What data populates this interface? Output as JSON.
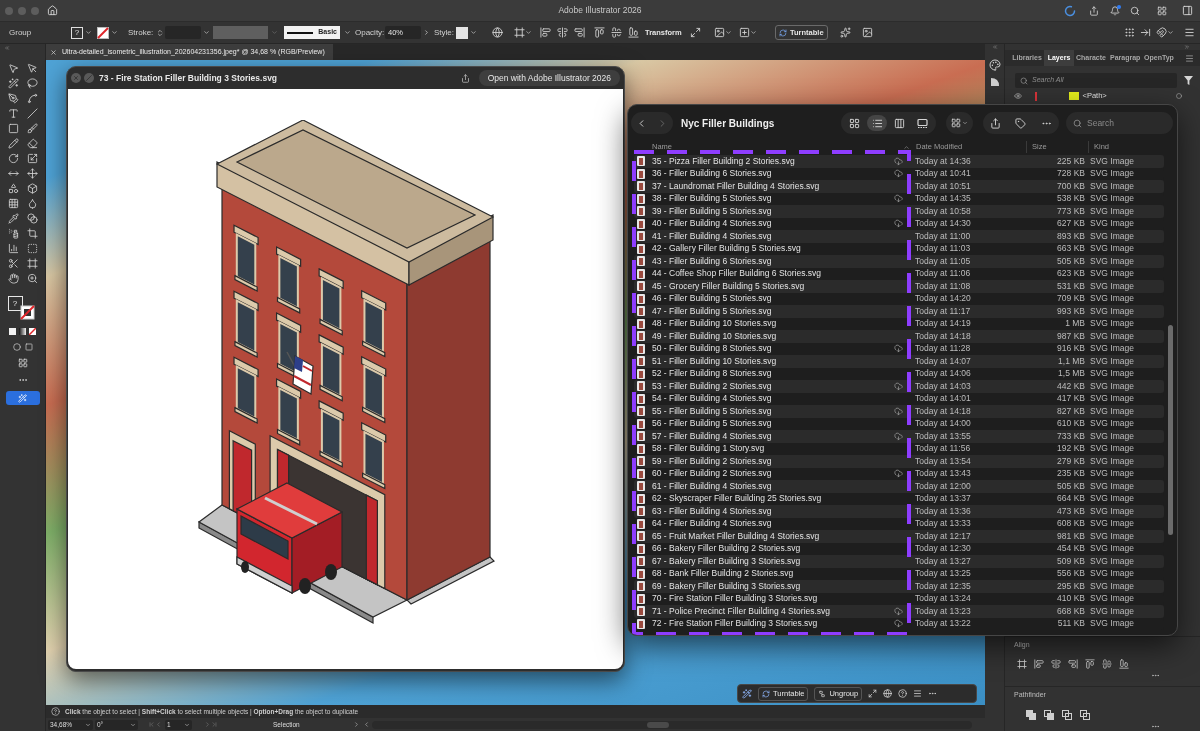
{
  "app": {
    "title": "Adobe Illustrator 2026"
  },
  "control_bar": {
    "selection": "Group",
    "fill": "?",
    "stroke_label": "Stroke:",
    "brush": "Basic",
    "opacity_label": "Opacity:",
    "opacity": "40%",
    "style_label": "Style:",
    "transform": "Transform",
    "turntable": "Turntable"
  },
  "tools": {
    "fill": "?"
  },
  "document_tab": {
    "title": "Ultra-detailed_isometric_illustration_202604231356.jpeg* @ 34,68 % (RGB/Preview)"
  },
  "quick_look": {
    "title": "73 - Fire Station Filler Building 3 Stories.svg",
    "open_button": "Open with Adobe Illustrator 2026"
  },
  "finder": {
    "title": "Nyc Filler Buildings",
    "view_modes": [
      {
        "kind": "icons",
        "selected": false
      },
      {
        "kind": "list",
        "selected": true
      },
      {
        "kind": "columns",
        "selected": false
      },
      {
        "kind": "gallery",
        "selected": false
      }
    ],
    "search": {
      "placeholder": "Search"
    },
    "columns": [
      "Name",
      "Date Modified",
      "Size",
      "Kind"
    ],
    "rows": [
      {
        "name": "35 - Pizza Filler Building 2 Stories.svg",
        "date": "Today at 14:36",
        "size": "225 KB",
        "file_type": "SVG Image",
        "cloud": true
      },
      {
        "name": "36 - Filler Building 6 Stories.svg",
        "date": "Today at 10:41",
        "size": "728 KB",
        "file_type": "SVG Image",
        "cloud": true
      },
      {
        "name": "37 - Laundromat Filler Building 4 Stories.svg",
        "date": "Today at 10:51",
        "size": "700 KB",
        "file_type": "SVG Image",
        "cloud": false
      },
      {
        "name": "38 - Filler Building 5 Stories.svg",
        "date": "Today at 14:35",
        "size": "538 KB",
        "file_type": "SVG Image",
        "cloud": true
      },
      {
        "name": "39 - Filler Building 5 Stories.svg",
        "date": "Today at 10:58",
        "size": "773 KB",
        "file_type": "SVG Image",
        "cloud": false
      },
      {
        "name": "40 - Filler Building 4 Stories.svg",
        "date": "Today at 14:30",
        "size": "627 KB",
        "file_type": "SVG Image",
        "cloud": true
      },
      {
        "name": "41 - Filler Building 4 Stories.svg",
        "date": "Today at 11:00",
        "size": "893 KB",
        "file_type": "SVG Image",
        "cloud": false
      },
      {
        "name": "42 - Gallery Filler Building 5 Stories.svg",
        "date": "Today at 11:03",
        "size": "663 KB",
        "file_type": "SVG Image",
        "cloud": false
      },
      {
        "name": "43 - Filler Building 6 Stories.svg",
        "date": "Today at 11:05",
        "size": "505 KB",
        "file_type": "SVG Image",
        "cloud": false
      },
      {
        "name": "44 - Coffee Shop Filler Building 6 Stories.svg",
        "date": "Today at 11:06",
        "size": "623 KB",
        "file_type": "SVG Image",
        "cloud": false
      },
      {
        "name": "45 - Grocery Filler Building 5 Stories.svg",
        "date": "Today at 11:08",
        "size": "531 KB",
        "file_type": "SVG Image",
        "cloud": false
      },
      {
        "name": "46 - Filler Building 5 Stories.svg",
        "date": "Today at 14:20",
        "size": "709 KB",
        "file_type": "SVG Image",
        "cloud": false
      },
      {
        "name": "47 - Filler Building 5 Stories.svg",
        "date": "Today at 11:17",
        "size": "993 KB",
        "file_type": "SVG Image",
        "cloud": false
      },
      {
        "name": "48 - Filler Building 10 Stories.svg",
        "date": "Today at 14:19",
        "size": "1 MB",
        "file_type": "SVG Image",
        "cloud": false
      },
      {
        "name": "49 - Filler Building 10 Stories.svg",
        "date": "Today at 14:18",
        "size": "987 KB",
        "file_type": "SVG Image",
        "cloud": false
      },
      {
        "name": "50 - Filler Building 8 Stories.svg",
        "date": "Today at 11:28",
        "size": "916 KB",
        "file_type": "SVG Image",
        "cloud": true
      },
      {
        "name": "51 - Filler Building 10 Stories.svg",
        "date": "Today at 14:07",
        "size": "1,1 MB",
        "file_type": "SVG Image",
        "cloud": false
      },
      {
        "name": "52 - Filler Building 8 Stories.svg",
        "date": "Today at 14:06",
        "size": "1,5 MB",
        "file_type": "SVG Image",
        "cloud": false
      },
      {
        "name": "53 - Filler Building 2 Stories.svg",
        "date": "Today at 14:03",
        "size": "442 KB",
        "file_type": "SVG Image",
        "cloud": true
      },
      {
        "name": "54 - Filler Building 4 Stories.svg",
        "date": "Today at 14:01",
        "size": "417 KB",
        "file_type": "SVG Image",
        "cloud": false
      },
      {
        "name": "55 - Filler Building 5 Stories.svg",
        "date": "Today at 14:18",
        "size": "827 KB",
        "file_type": "SVG Image",
        "cloud": true
      },
      {
        "name": "56 - Filler Building 5 Stories.svg",
        "date": "Today at 14:00",
        "size": "610 KB",
        "file_type": "SVG Image",
        "cloud": false
      },
      {
        "name": "57 - Filler Building 4 Stories.svg",
        "date": "Today at 13:55",
        "size": "733 KB",
        "file_type": "SVG Image",
        "cloud": true
      },
      {
        "name": "58 - Filler Building 1 Story.svg",
        "date": "Today at 11:56",
        "size": "192 KB",
        "file_type": "SVG Image",
        "cloud": false
      },
      {
        "name": "59 - Filler Building 2 Stories.svg",
        "date": "Today at 13:54",
        "size": "279 KB",
        "file_type": "SVG Image",
        "cloud": false
      },
      {
        "name": "60 - Filler Building 2 Stories.svg",
        "date": "Today at 13:43",
        "size": "235 KB",
        "file_type": "SVG Image",
        "cloud": true
      },
      {
        "name": "61 - Filler Building 4 Stories.svg",
        "date": "Today at 12:00",
        "size": "505 KB",
        "file_type": "SVG Image",
        "cloud": false
      },
      {
        "name": "62 - Skyscraper Filler Building 25 Stories.svg",
        "date": "Today at 13:37",
        "size": "664 KB",
        "file_type": "SVG Image",
        "cloud": false
      },
      {
        "name": "63 - Filler Building 4 Stories.svg",
        "date": "Today at 13:36",
        "size": "473 KB",
        "file_type": "SVG Image",
        "cloud": false
      },
      {
        "name": "64 - Filler Building 4 Stories.svg",
        "date": "Today at 13:33",
        "size": "608 KB",
        "file_type": "SVG Image",
        "cloud": false
      },
      {
        "name": "65 - Fruit Market Filler Building 4 Stories.svg",
        "date": "Today at 12:17",
        "size": "981 KB",
        "file_type": "SVG Image",
        "cloud": false
      },
      {
        "name": "66 - Bakery Filler Building 2 Stories.svg",
        "date": "Today at 12:30",
        "size": "454 KB",
        "file_type": "SVG Image",
        "cloud": false
      },
      {
        "name": "67 - Bakery Filler Building 3 Stories.svg",
        "date": "Today at 13:27",
        "size": "509 KB",
        "file_type": "SVG Image",
        "cloud": false
      },
      {
        "name": "68 - Bank Filler Building 2 Stories.svg",
        "date": "Today at 13:25",
        "size": "556 KB",
        "file_type": "SVG Image",
        "cloud": false
      },
      {
        "name": "69 - Bakery Filler Building 3 Stories.svg",
        "date": "Today at 12:35",
        "size": "295 KB",
        "file_type": "SVG Image",
        "cloud": false
      },
      {
        "name": "70 - Fire Station Filler Building 3 Stories.svg",
        "date": "Today at 13:24",
        "size": "410 KB",
        "file_type": "SVG Image",
        "cloud": false
      },
      {
        "name": "71 - Police Precinct Filler Building 4 Stories.svg",
        "date": "Today at 13:23",
        "size": "668 KB",
        "file_type": "SVG Image",
        "cloud": true
      },
      {
        "name": "72 - Fire Station Filler Building 3 Stories.svg",
        "date": "Today at 13:22",
        "size": "511 KB",
        "file_type": "SVG Image",
        "cloud": true
      }
    ]
  },
  "panel": {
    "tabs": [
      {
        "label": "Libraries",
        "selected": false
      },
      {
        "label": "Layers",
        "selected": true
      },
      {
        "label": "Characte",
        "selected": false
      },
      {
        "label": "Paragrap",
        "selected": false
      },
      {
        "label": "OpenTyp",
        "selected": false
      }
    ],
    "search": {
      "placeholder": "Search All"
    },
    "layers": [
      {
        "name": "<Path>"
      }
    ],
    "sections": [
      "Align",
      "Pathfinder"
    ]
  },
  "task_bar": {
    "buttons": [
      "Turntable",
      "Ungroup"
    ]
  },
  "hint": "**Click** the object to select | **Shift+Click** to select multiple objects | **Option+Drag** the object to duplicate",
  "status_bar": {
    "zoom": "34,68%",
    "rotation": "0°",
    "artboard": "1",
    "tool": "Selection"
  }
}
